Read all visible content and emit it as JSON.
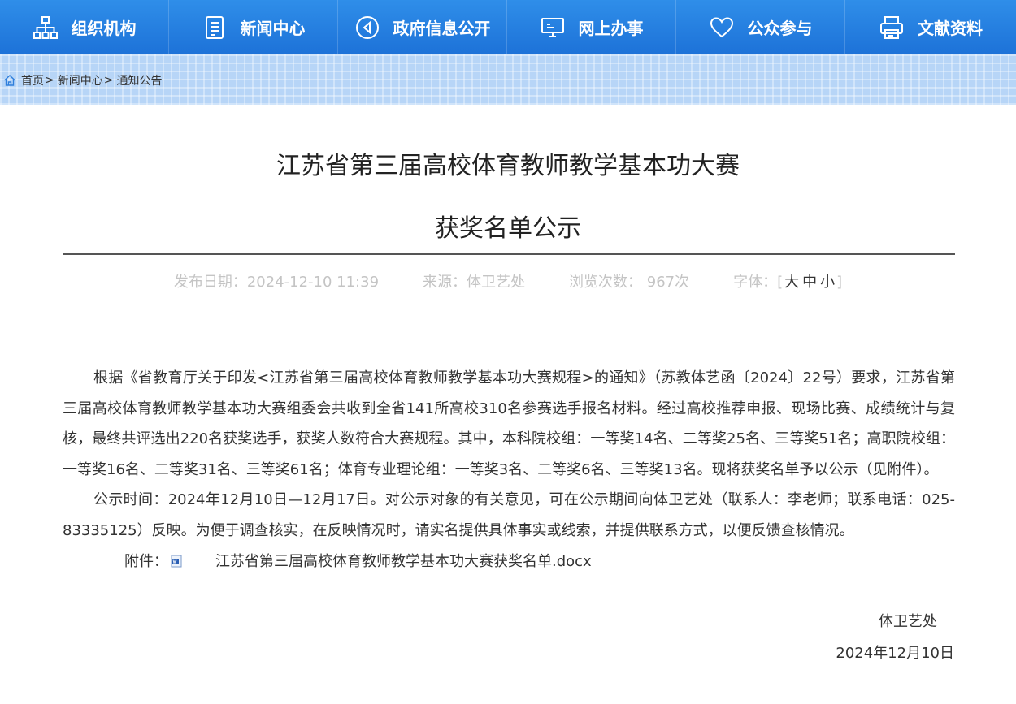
{
  "nav": {
    "items": [
      {
        "label": "组织机构",
        "icon": "org-chart-icon"
      },
      {
        "label": "新闻中心",
        "icon": "document-icon"
      },
      {
        "label": "政府信息公开",
        "icon": "play-circle-icon"
      },
      {
        "label": "网上办事",
        "icon": "monitor-icon"
      },
      {
        "label": "公众参与",
        "icon": "heart-icon"
      },
      {
        "label": "文献资料",
        "icon": "printer-icon"
      }
    ]
  },
  "breadcrumb": {
    "home": "首页",
    "sep": ">",
    "news": "新闻中心",
    "notice": "通知公告"
  },
  "article": {
    "title_line1": "江苏省第三届高校体育教师教学基本功大赛",
    "title_line2": "获奖名单公示",
    "meta": {
      "date": "发布日期：2024-12-10 11:39",
      "source": "来源：体卫艺处",
      "views": "浏览次数： 967次",
      "font_label": "字体：[",
      "font_large": "大",
      "font_medium": "中",
      "font_small": "小",
      "font_close": "]"
    },
    "para1": "根据《省教育厅关于印发<江苏省第三届高校体育教师教学基本功大赛规程>的通知》（苏教体艺函〔2024〕22号）要求，江苏省第三届高校体育教师教学基本功大赛组委会共收到全省141所高校310名参赛选手报名材料。经过高校推荐申报、现场比赛、成绩统计与复核，最终共评选出220名获奖选手，获奖人数符合大赛规程。其中，本科院校组：一等奖14名、二等奖25名、三等奖51名；高职院校组：一等奖16名、二等奖31名、三等奖61名；体育专业理论组：一等奖3名、二等奖6名、三等奖13名。现将获奖名单予以公示（见附件）。",
    "para2": "公示时间：2024年12月10日—12月17日。对公示对象的有关意见，可在公示期间向体卫艺处（联系人：李老师；联系电话：025-83335125）反映。为便于调查核实，在反映情况时，请实名提供具体事实或线索，并提供联系方式，以便反馈查核情况。",
    "attachment_label": "附件：",
    "attachment_name": "江苏省第三届高校体育教师教学基本功大赛获奖名单.docx",
    "signature": "体卫艺处",
    "sign_date": "2024年12月10日"
  },
  "colors": {
    "nav_bg": "#1f78dd",
    "band_bg": "#b7d5f7",
    "meta_text": "#c4c4c4",
    "body_text": "#333333"
  }
}
